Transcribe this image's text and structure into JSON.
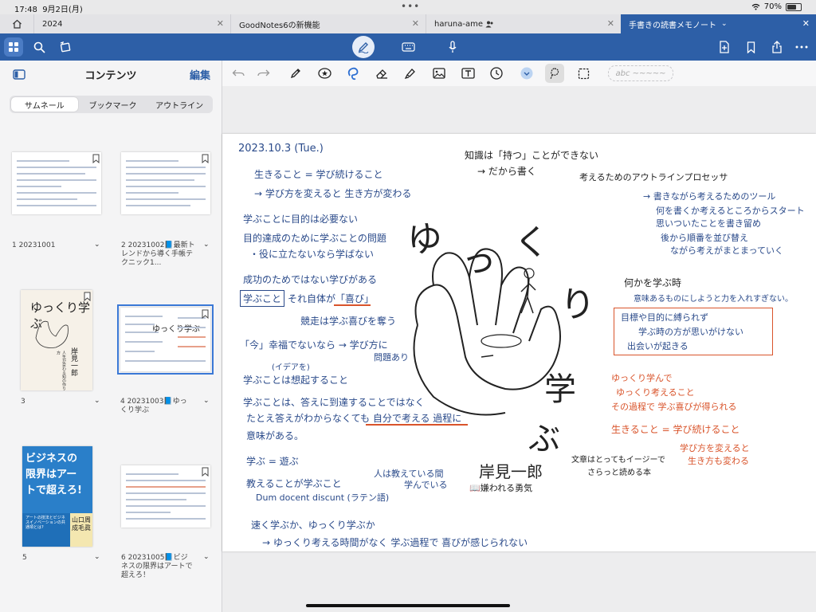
{
  "status": {
    "time": "17:48",
    "date": "9月2日(月)",
    "battery_pct": "70%",
    "battery_level": 0.7
  },
  "tabs": [
    {
      "label": "2024"
    },
    {
      "label": "GoodNotes6の新機能"
    },
    {
      "label": "haruna-ame"
    },
    {
      "label": "手書きの読書メモノート"
    }
  ],
  "sidebar": {
    "title": "コンテンツ",
    "edit": "編集",
    "segments": [
      "サムネール",
      "ブックマーク",
      "アウトライン"
    ],
    "thumbs": [
      {
        "num": "1",
        "label": "20231001"
      },
      {
        "num": "2",
        "label": "20231002📘最新トレンドから導く手帳テクニック1..."
      },
      {
        "num": "3",
        "label": ""
      },
      {
        "num": "4",
        "label": "20231003📘ゆっくり学ぶ"
      },
      {
        "num": "5",
        "label": ""
      },
      {
        "num": "6",
        "label": "20231005📘ビジネスの限界はアートで超えろ！"
      }
    ],
    "book1": {
      "title": "ゆっくり学ぶ",
      "author": "岸見一郎",
      "sub": "人生が変わる知の作り方"
    },
    "book2": {
      "title_lines": [
        "ビジネスの",
        "限界はアー",
        "トで超えろ!"
      ],
      "sub": "アートの技法とビジネスイノベーションの共通項とは?",
      "author": "山口周 成毛眞"
    }
  },
  "canvas": {
    "abc": "abc"
  },
  "note": {
    "date": "2023.10.3 (Tue.)",
    "l1": "生きること = 学び続けること",
    "l2": "→ 学び方を変えると 生き方が変わる",
    "l3": "学ぶことに目的は必要ない",
    "l4": "目的達成のために学ぶことの問題",
    "l5": "・役に立たないなら学ばない",
    "l6": "成功のためではない学びがある",
    "l7a": "学ぶこと",
    "l7b": "それ自体が「喜び」",
    "l8": "競走は学ぶ喜びを奪う",
    "l9": "「今」幸福でないなら → 学び方に",
    "l9b": "問題あり",
    "l10note": "(イデアを)",
    "l10": "学ぶことは想起すること",
    "l11": "学ぶことは、答えに到達することではなく",
    "l12": "たとえ答えがわからなくても 自分で考える 過程に",
    "l13": "意味がある。",
    "l14": "学ぶ = 遊ぶ",
    "l15": "教えることが学ぶこと",
    "l15b": "人は教えている間",
    "l15c": "学んでいる",
    "l16": "Dum docent discunt (ラテン語)",
    "l17": "速く学ぶか、ゆっくり学ぶか",
    "l18": "→ ゆっくり考える時間がなく 学ぶ過程で 喜びが感じられない",
    "r1": "知識は「持つ」ことができない",
    "r2": "→ だから書く",
    "r3": "考えるためのアウトラインプロセッサ",
    "r4": "→ 書きながら考えるためのツール",
    "r5": "何を書くか考えるところからスタート",
    "r6": "思いついたことを書き留め",
    "r7": "後から順番を並び替え",
    "r8": "ながら考えがまとまっていく",
    "r9": "何かを学ぶ時",
    "r10": "意味あるものにしようと力を入れすぎない。",
    "box1": "目標や目的に縛られず",
    "box2": "学ぶ時の方が思いがけない",
    "box3": "出会いが起きる",
    "o1": "ゆっくり学んで",
    "o2": "ゆっくり考えること",
    "o3": "その過程で 学ぶ喜びが得られる",
    "o4": "生きること = 学び続けること",
    "o5": "学び方を変えると",
    "o6": "生き方も変わる",
    "r11": "文章はとってもイージーで",
    "r12": "さらっと読める本",
    "cover_big": [
      "ゆ",
      "っ",
      "く",
      "り"
    ],
    "cover_big2": [
      "学",
      "ぶ"
    ],
    "author": "岸見一郎",
    "related": "📖嫌われる勇気"
  }
}
